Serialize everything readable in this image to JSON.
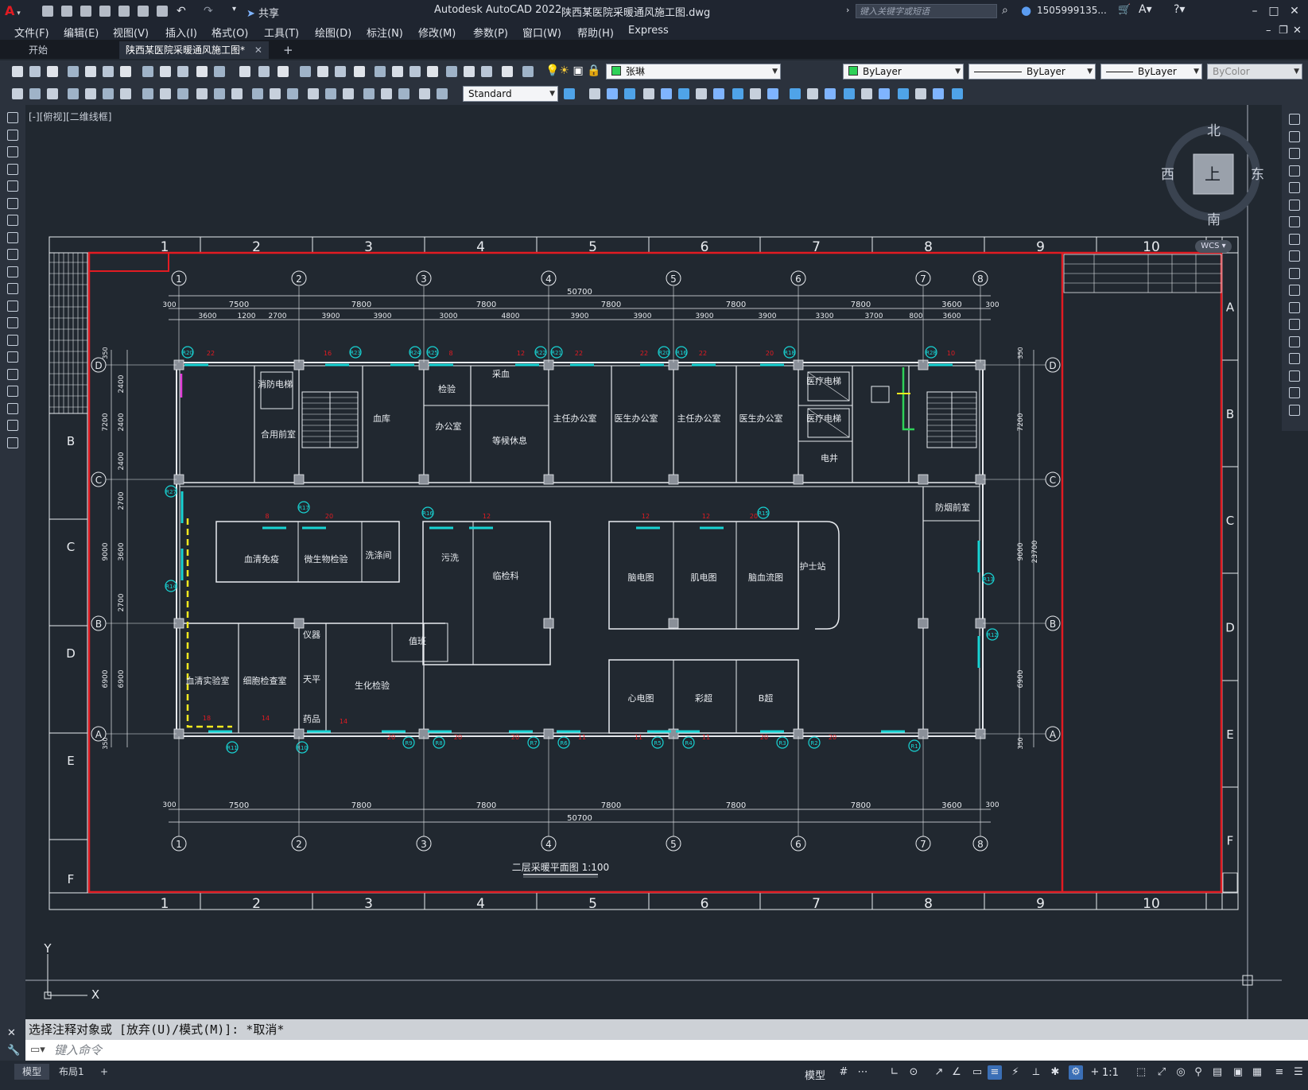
{
  "app": {
    "title": "Autodesk AutoCAD 2022",
    "file_name": "陕西某医院采暖通风施工图.dwg",
    "share_label": "共享",
    "search_placeholder": "键入关键字或短语",
    "user": "1505999135...",
    "brand_color": "#e21b22"
  },
  "menu": [
    "文件(F)",
    "编辑(E)",
    "视图(V)",
    "插入(I)",
    "格式(O)",
    "工具(T)",
    "绘图(D)",
    "标注(N)",
    "修改(M)",
    "参数(P)",
    "窗口(W)",
    "帮助(H)",
    "Express"
  ],
  "tabs": {
    "start": "开始",
    "document": "陕西某医院采暖通风施工图*",
    "add": "+"
  },
  "toolbar": {
    "layer": "张琳",
    "color": "ByLayer",
    "linetype": "ByLayer",
    "lineweight": "ByLayer",
    "plotstyle": "ByColor",
    "text_style": "Standard"
  },
  "viewport": {
    "label": "[-][俯视][二维线框]",
    "wcs": "WCS",
    "viewcube": {
      "north": "北",
      "south": "南",
      "east": "东",
      "west": "西",
      "top": "上"
    }
  },
  "drawing": {
    "sheet_title": "二层采暖平面图 1:100",
    "frame_cols": [
      "1",
      "2",
      "3",
      "4",
      "5",
      "6",
      "7",
      "8",
      "9",
      "10"
    ],
    "frame_rows": [
      "A",
      "B",
      "C",
      "D",
      "E",
      "F"
    ],
    "left_rows": [
      "B",
      "C",
      "D",
      "E",
      "F"
    ],
    "axes_cols": [
      "1",
      "2",
      "3",
      "4",
      "5",
      "6",
      "7",
      "8"
    ],
    "axes_rows": [
      "D",
      "C",
      "B",
      "A"
    ],
    "top_total": "50700",
    "top_spans": [
      "7500",
      "7800",
      "7800",
      "7800",
      "7800",
      "7800",
      "3600"
    ],
    "top_sub": [
      "3600",
      "1200",
      "2700",
      "3900",
      "3900",
      "3000",
      "4800",
      "3900",
      "3900",
      "3900",
      "3900",
      "3300",
      "3700",
      "800",
      "3600"
    ],
    "bottom_total": "50700",
    "bottom_spans": [
      "7500",
      "7800",
      "7800",
      "7800",
      "7800",
      "7800",
      "3600"
    ],
    "edge_300": "300",
    "left_dims": [
      "7200",
      "9000",
      "6900"
    ],
    "left_sub": [
      "2400",
      "2400",
      "2400",
      "2700",
      "3600",
      "2700",
      "6900"
    ],
    "right_dims": [
      "7200",
      "9000",
      "6900"
    ],
    "right_total": "23700",
    "edge_350": "350",
    "rooms": [
      {
        "name": "消防电梯"
      },
      {
        "name": "合用前室"
      },
      {
        "name": "血库"
      },
      {
        "name": "检验"
      },
      {
        "name": "采血"
      },
      {
        "name": "办公室"
      },
      {
        "name": "等候休息"
      },
      {
        "name": "主任办公室"
      },
      {
        "name": "医生办公室"
      },
      {
        "name": "主任办公室"
      },
      {
        "name": "医生办公室"
      },
      {
        "name": "医疗电梯"
      },
      {
        "name": "医疗电梯"
      },
      {
        "name": "电井"
      },
      {
        "name": "防烟前室"
      },
      {
        "name": "血清免疫"
      },
      {
        "name": "微生物检验"
      },
      {
        "name": "洗涤间"
      },
      {
        "name": "污洗"
      },
      {
        "name": "临检科"
      },
      {
        "name": "脑电图"
      },
      {
        "name": "肌电图"
      },
      {
        "name": "脑血流图"
      },
      {
        "name": "护士站"
      },
      {
        "name": "血清实验室"
      },
      {
        "name": "细胞检查室"
      },
      {
        "name": "仪器"
      },
      {
        "name": "天平"
      },
      {
        "name": "药品"
      },
      {
        "name": "生化检验"
      },
      {
        "name": "值班"
      },
      {
        "name": "心电图"
      },
      {
        "name": "彩超"
      },
      {
        "name": "B超"
      }
    ],
    "radiator_tags": [
      "R20",
      "R23",
      "R24",
      "R25",
      "R22",
      "R21",
      "R20",
      "R16",
      "R18",
      "R28",
      "R27",
      "R17",
      "R16",
      "R15",
      "R14",
      "R13",
      "R12",
      "R11",
      "R10",
      "R9",
      "R8",
      "R7",
      "R6",
      "R5",
      "R4",
      "R3",
      "R2",
      "R1"
    ],
    "radiator_counts": [
      "22",
      "16",
      "8",
      "12",
      "22",
      "22",
      "22",
      "20",
      "10",
      "8",
      "20",
      "12",
      "12",
      "12",
      "20",
      "18",
      "14",
      "14",
      "20",
      "20",
      "20",
      "11",
      "11",
      "11",
      "20",
      "20"
    ]
  },
  "command": {
    "history": "选择注释对象或 [放弃(U)/模式(M)]: *取消*",
    "placeholder": "键入命令"
  },
  "status": {
    "layout_tabs": [
      "模型",
      "布局1"
    ],
    "model_label": "模型",
    "scale": "1:1"
  }
}
